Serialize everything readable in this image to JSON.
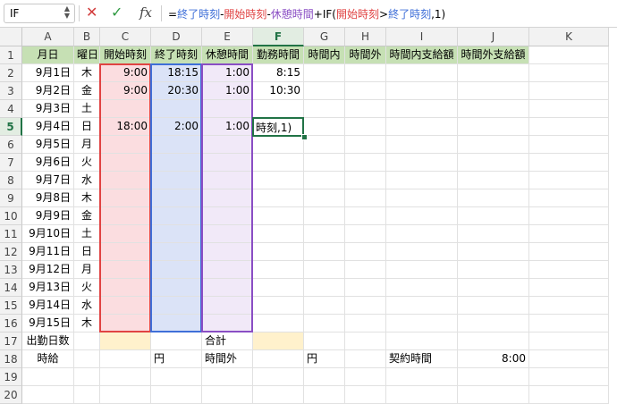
{
  "name_box": "IF",
  "formula_bar": {
    "cancel_icon": "close-icon",
    "enter_icon": "check-icon",
    "fx_label": "fx",
    "parts": [
      {
        "text": "=",
        "color": "black"
      },
      {
        "text": "終了時刻",
        "color": "blue"
      },
      {
        "text": "-",
        "color": "black"
      },
      {
        "text": "開始時刻",
        "color": "red"
      },
      {
        "text": "-",
        "color": "black"
      },
      {
        "text": "休憩時間",
        "color": "purple"
      },
      {
        "text": "+IF(",
        "color": "black"
      },
      {
        "text": "開始時刻",
        "color": "red"
      },
      {
        "text": ">",
        "color": "black"
      },
      {
        "text": "終了時刻",
        "color": "blue"
      },
      {
        "text": ",1)",
        "color": "black"
      }
    ]
  },
  "columns": [
    "A",
    "B",
    "C",
    "D",
    "E",
    "F",
    "G",
    "H",
    "I",
    "J",
    "K"
  ],
  "selected_column": "F",
  "rows": [
    "1",
    "2",
    "3",
    "4",
    "5",
    "6",
    "7",
    "8",
    "9",
    "10",
    "11",
    "12",
    "13",
    "14",
    "15",
    "16",
    "17",
    "18",
    "19",
    "20"
  ],
  "selected_row": "5",
  "header_row": [
    "月日",
    "曜日",
    "開始時刻",
    "終了時刻",
    "休憩時間",
    "勤務時間",
    "時間内",
    "時間外",
    "時間内支給額",
    "時間外支給額"
  ],
  "days": [
    {
      "date": "9月1日",
      "wd": "木",
      "start": "9:00",
      "end": "18:15",
      "brk": "1:00",
      "work": "8:15"
    },
    {
      "date": "9月2日",
      "wd": "金",
      "start": "9:00",
      "end": "20:30",
      "brk": "1:00",
      "work": "10:30"
    },
    {
      "date": "9月3日",
      "wd": "土",
      "start": "",
      "end": "",
      "brk": "",
      "work": ""
    },
    {
      "date": "9月4日",
      "wd": "日",
      "start": "18:00",
      "end": "2:00",
      "brk": "1:00",
      "work": ""
    },
    {
      "date": "9月5日",
      "wd": "月",
      "start": "",
      "end": "",
      "brk": "",
      "work": ""
    },
    {
      "date": "9月6日",
      "wd": "火",
      "start": "",
      "end": "",
      "brk": "",
      "work": ""
    },
    {
      "date": "9月7日",
      "wd": "水",
      "start": "",
      "end": "",
      "brk": "",
      "work": ""
    },
    {
      "date": "9月8日",
      "wd": "木",
      "start": "",
      "end": "",
      "brk": "",
      "work": ""
    },
    {
      "date": "9月9日",
      "wd": "金",
      "start": "",
      "end": "",
      "brk": "",
      "work": ""
    },
    {
      "date": "9月10日",
      "wd": "土",
      "start": "",
      "end": "",
      "brk": "",
      "work": ""
    },
    {
      "date": "9月11日",
      "wd": "日",
      "start": "",
      "end": "",
      "brk": "",
      "work": ""
    },
    {
      "date": "9月12日",
      "wd": "月",
      "start": "",
      "end": "",
      "brk": "",
      "work": ""
    },
    {
      "date": "9月13日",
      "wd": "火",
      "start": "",
      "end": "",
      "brk": "",
      "work": ""
    },
    {
      "date": "9月14日",
      "wd": "水",
      "start": "",
      "end": "",
      "brk": "",
      "work": ""
    },
    {
      "date": "9月15日",
      "wd": "木",
      "start": "",
      "end": "",
      "brk": "",
      "work": ""
    }
  ],
  "active_cell_text": "時刻,1)",
  "row17": {
    "a": "出勤日数",
    "e": "合計"
  },
  "row18": {
    "a": "時給",
    "d": "円",
    "e": "時間外",
    "g": "円",
    "i": "契約時間",
    "j": "8:00"
  },
  "colors": {
    "red": "#e04343",
    "blue": "#3f6fd8",
    "purple": "#8a4ec4",
    "green": "#217346",
    "header_fill": "#c6e0b4"
  }
}
